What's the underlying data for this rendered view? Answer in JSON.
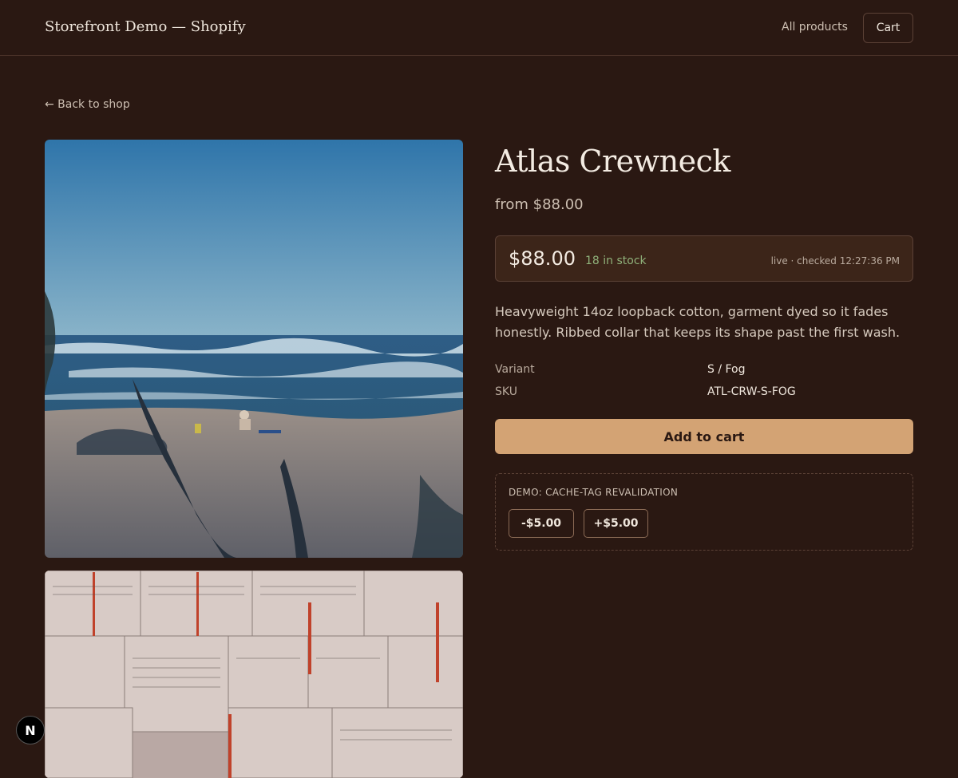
{
  "header": {
    "brand": "Storefront Demo — Shopify",
    "nav_all_products": "All products",
    "cart_label": "Cart"
  },
  "back_link": "← Back to shop",
  "product": {
    "title": "Atlas Crewneck",
    "from_price": "from $88.00",
    "price": "$88.00",
    "stock": "18 in stock",
    "live_status": "live · checked 12:27:36 PM",
    "description": "Heavyweight 14oz loopback cotton, garment dyed so it fades honestly. Ribbed collar that keeps its shape past the first wash.",
    "variant_label": "Variant",
    "variant_value": "S / Fog",
    "sku_label": "SKU",
    "sku_value": "ATL-CRW-S-FOG",
    "add_to_cart": "Add to cart"
  },
  "demo": {
    "title": "DEMO: CACHE-TAG REVALIDATION",
    "minus_label": "-$5.00",
    "plus_label": "+$5.00"
  },
  "badge_letter": "N",
  "colors": {
    "background": "#2a1812",
    "accent": "#d3a374",
    "stock_green": "#8fb17a"
  }
}
